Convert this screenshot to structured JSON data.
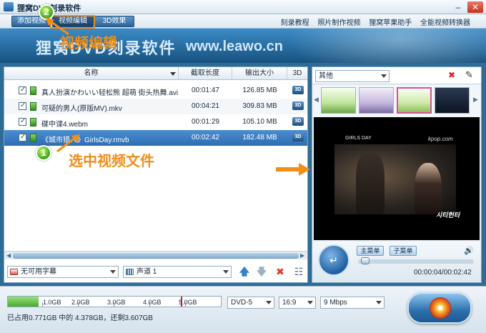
{
  "window": {
    "title": "狸窝DVD刻录软件",
    "minimize": "–",
    "close": "✕"
  },
  "menubar": {
    "tabs": [
      {
        "label": "添加视频"
      },
      {
        "label": "视频编辑"
      },
      {
        "label": "3D效果"
      }
    ],
    "links": [
      "刻录教程",
      "照片制作视频",
      "狸窝苹果助手",
      "全能视频转换器"
    ]
  },
  "banner": {
    "brand": "狸窝DVD刻录软件",
    "site": "www.leawo.cn"
  },
  "file_table": {
    "columns": [
      "名称",
      "截取长度",
      "输出大小",
      "3D"
    ],
    "rows": [
      {
        "name": "真人扮演かわいい轻松熊 超萌 街头热舞.avi",
        "duration": "00:01:47",
        "size": "126.85 MB",
        "badge": "3D",
        "checked": true
      },
      {
        "name": "可疑的男人(原版MV).mkv",
        "duration": "00:04:21",
        "size": "309.83 MB",
        "badge": "3D",
        "checked": true
      },
      {
        "name": "碟中谍4.webm",
        "duration": "00:01:29",
        "size": "105.10 MB",
        "badge": "3D",
        "checked": true
      },
      {
        "name": "《城市猎人》GirlsDay.rmvb",
        "duration": "00:02:42",
        "size": "182.48 MB",
        "badge": "3D",
        "checked": true,
        "selected": true
      }
    ]
  },
  "tools": {
    "subtitle": "无可用字幕",
    "audio": "声道 1",
    "up": "🡅",
    "down": "🡇",
    "delete": "✖",
    "clear": "☷"
  },
  "menu_panel": {
    "theme": "其他",
    "delete_icon": "✖",
    "edit_icon": "✎",
    "main_menu": "主菜单",
    "sub_menu": "子菜单",
    "time": "00:00:04/00:02:42",
    "progress": 0.025,
    "watermarks": [
      "GIRLS DAY",
      "kpop.com",
      "시티헌터"
    ]
  },
  "bottom": {
    "ticks": [
      "1.0GB",
      "2.0GB",
      "3.0GB",
      "4.0GB",
      "5.0GB"
    ],
    "used_fraction": 0.144,
    "limit_fraction": 0.812,
    "capacity_info": "已占用0.771GB 中的 4.378GB，还剩3.607GB",
    "disc_type": "DVD-5",
    "aspect": "16:9",
    "bitrate": "9 Mbps"
  },
  "annotations": {
    "step1_num": "1",
    "step1_text": "选中视频文件",
    "step2_num": "2",
    "step2_text": "视频编辑",
    "arrow_color": "#f18e18",
    "circle_color": "#3f9d1c"
  }
}
